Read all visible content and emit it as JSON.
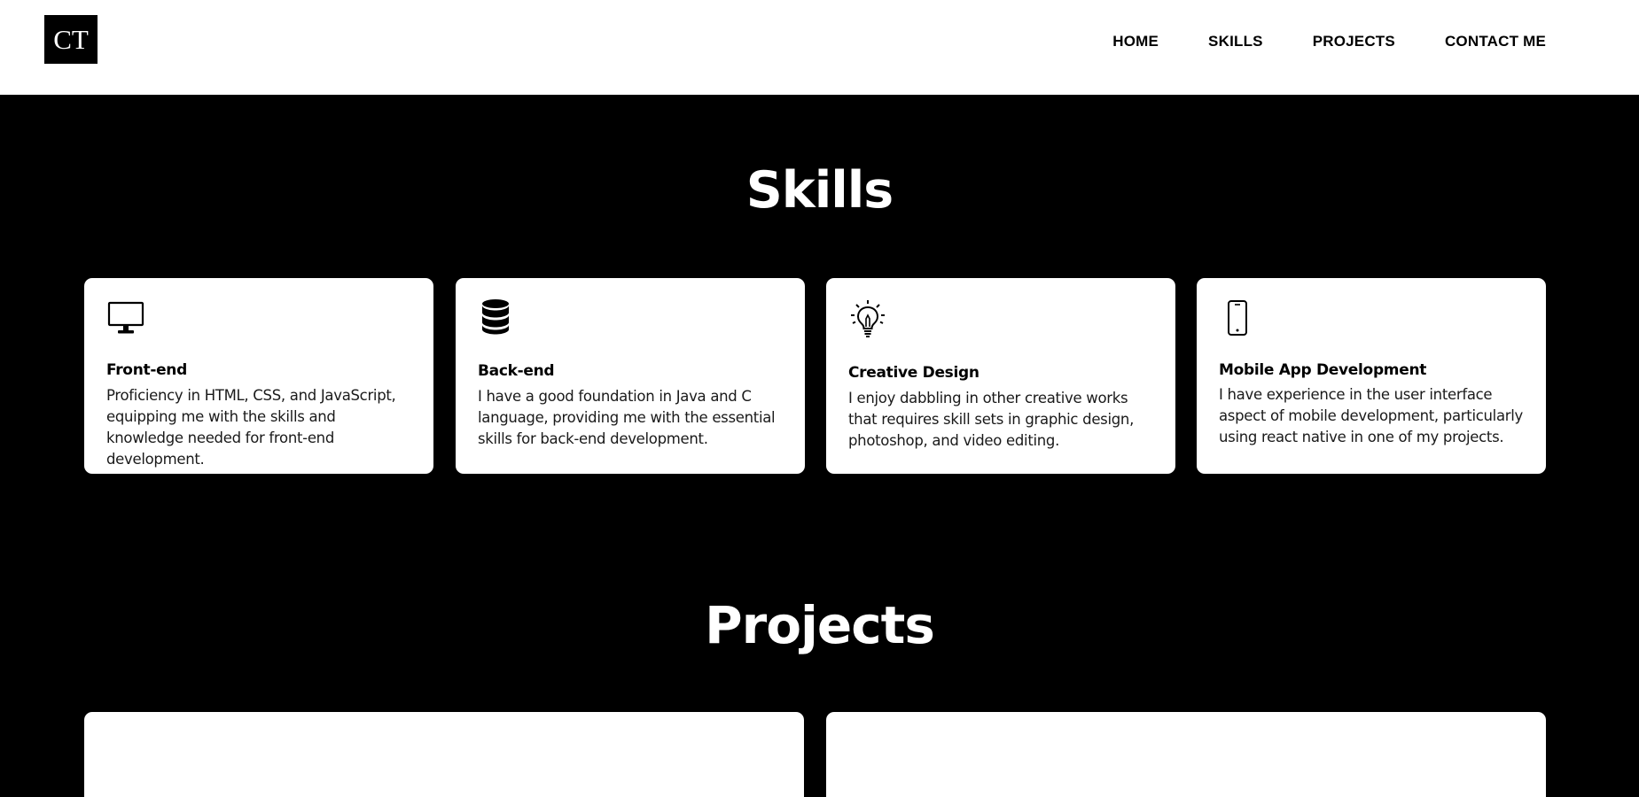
{
  "header": {
    "logo": "CT",
    "nav": [
      "HOME",
      "SKILLS",
      "PROJECTS",
      "CONTACT ME"
    ]
  },
  "skills": {
    "title": "Skills",
    "cards": [
      {
        "icon": "monitor-icon",
        "title": "Front-end",
        "description": "Proficiency in HTML, CSS, and JavaScript, equipping me with the skills and knowledge needed for front-end development."
      },
      {
        "icon": "database-icon",
        "title": "Back-end",
        "description": "I have a good foundation in Java and C language, providing me with the essential skills for back-end development."
      },
      {
        "icon": "lightbulb-icon",
        "title": "Creative Design",
        "description": "I enjoy dabbling in other creative works that requires skill sets in graphic design, photoshop, and video editing."
      },
      {
        "icon": "mobile-phone-icon",
        "title": "Mobile App Development",
        "description": "I have experience in the user interface aspect of mobile development, particularly using react native in one of my projects."
      }
    ]
  },
  "projects": {
    "title": "Projects"
  },
  "colors": {
    "background": "#000000",
    "header": "#ffffff",
    "card": "#ffffff",
    "text": "#000000"
  }
}
